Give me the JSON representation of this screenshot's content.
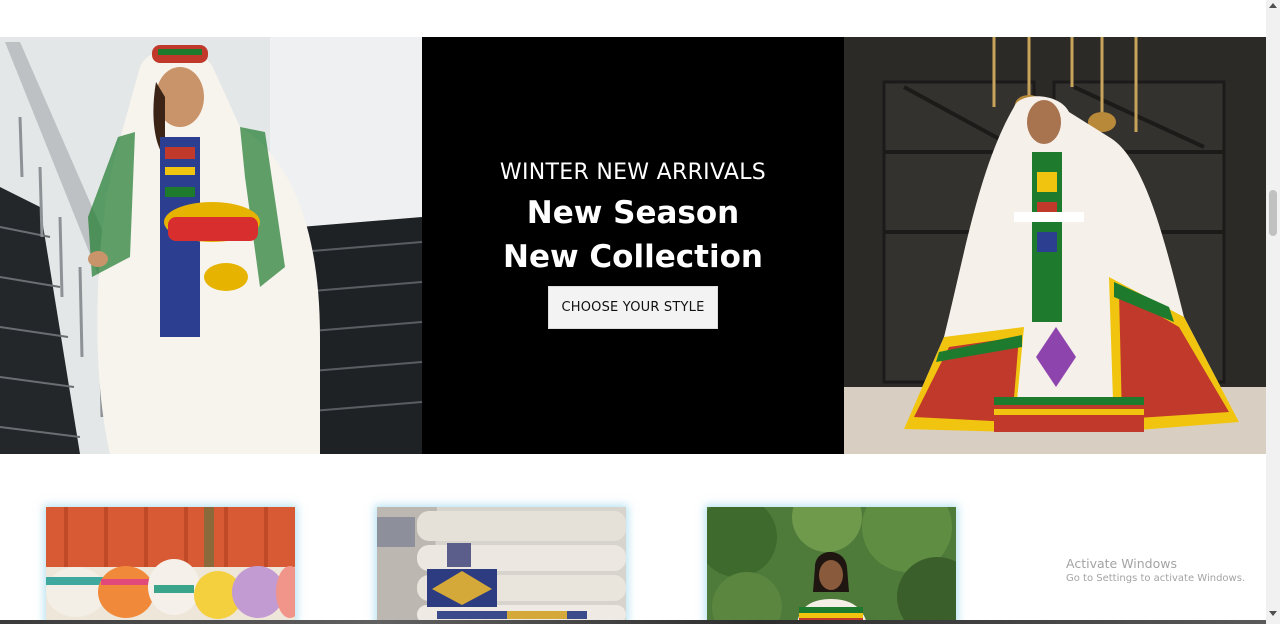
{
  "hero": {
    "kicker": "WINTER NEW ARRIVALS",
    "title_line1": "New Season",
    "title_line2": "New Collection",
    "cta_label": "CHOOSE YOUR STYLE",
    "left_image": "woman in white embroidered habesha dress holding a basket on stairs",
    "right_image": "woman in white habesha dress with green yellow red tibeb border",
    "panel_color": "#000000"
  },
  "products": [
    {
      "image": "stack of colorful woven scarves on red background"
    },
    {
      "image": "folded white cotton shawls with embroidered borders"
    },
    {
      "image": "woman in traditional dress among green trees"
    }
  ],
  "watermark": {
    "title": "Activate Windows",
    "subtitle": "Go to Settings to activate Windows."
  },
  "colors": {
    "accent_green": "#1e7b2e",
    "accent_yellow": "#f1c40f",
    "accent_red": "#c0392b",
    "card_glow": "#78c8e6"
  }
}
